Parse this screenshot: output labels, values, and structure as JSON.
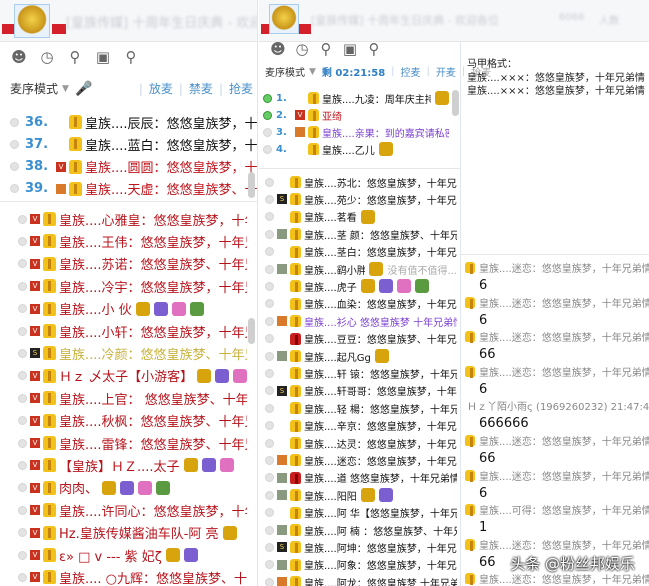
{
  "colors": {
    "accent": "#4a90c9",
    "name_red": "#b8141c",
    "purple": "#7b3fd0",
    "yellow": "#c9b23c"
  },
  "w1": {
    "title": "[皇族传媒] 十周年生日庆典 - 欢迎",
    "mode": "麦序模式",
    "actions": [
      "放麦",
      "禁麦",
      "抢麦"
    ],
    "top": [
      {
        "num": "36.",
        "name": "皇族....辰辰：悠悠皇族梦，十年",
        "color": "#111",
        "v": "none"
      },
      {
        "num": "37.",
        "name": "皇族....蓝白：悠悠皇族梦，十年",
        "color": "#111",
        "v": "none"
      },
      {
        "num": "38.",
        "name": "皇族....圆圆：悠悠皇族梦，十年",
        "color": "#c0141c",
        "v": "v"
      },
      {
        "num": "39.",
        "name": "皇族....天虚：悠悠皇族梦、十年",
        "color": "#c0141c",
        "v": "o"
      }
    ],
    "list": [
      {
        "name": "皇族....心雅皇：悠悠皇族梦，十年兄",
        "color": "#b8141c",
        "v": "v"
      },
      {
        "name": "皇族....王伟：悠悠皇族梦，十年兄弟",
        "color": "#b8141c",
        "v": "v"
      },
      {
        "name": "皇族....苏诺：悠悠皇族梦、十年兄弟",
        "color": "#b8141c",
        "v": "v"
      },
      {
        "name": "皇族....冷宇：悠悠皇族梦，十年兄弟",
        "color": "#b8141c",
        "v": "v"
      },
      {
        "name": "皇族....小  伙",
        "color": "#b8141c",
        "v": "v",
        "badges": 4
      },
      {
        "name": "皇族....小轩：悠悠皇族梦，十年兄弟",
        "color": "#b8141c",
        "v": "v"
      },
      {
        "name": "皇族....冷颜：悠悠皇族梦、十年兄弟",
        "color": "#c9b23c",
        "v": "s"
      },
      {
        "name": "Ｈｚ 乄太子【小游客】",
        "color": "#b8141c",
        "v": "v",
        "badges": 3
      },
      {
        "name": "皇族....上官： 悠悠皇族梦、十年兄",
        "color": "#b8141c",
        "v": "v"
      },
      {
        "name": "皇族....秋枫：悠悠皇族梦、十年兄弟",
        "color": "#b8141c",
        "v": "v"
      },
      {
        "name": "皇族....雷锋：悠悠皇族梦、十年兄弟",
        "color": "#b8141c",
        "v": "v"
      },
      {
        "name": "【皇族】ＨＺ....太子",
        "color": "#b8141c",
        "v": "v",
        "badges": 3
      },
      {
        "name": "肉肉、",
        "color": "#b8141c",
        "v": "v",
        "badges": 4
      },
      {
        "name": "皇族....许同心：悠悠皇族梦，十年兄",
        "color": "#b8141c",
        "v": "v"
      },
      {
        "name": "Hz.皇族传媒酱油车队-阿   亮",
        "color": "#b8141c",
        "v": "v",
        "badges": 1
      },
      {
        "name": "ε» □  v  ---   紫  妃ζ",
        "color": "#b8141c",
        "v": "v",
        "badges": 2
      },
      {
        "name": "皇族....  ○九辉：悠悠皇族梦、十年兄",
        "color": "#b8141c",
        "v": "v"
      }
    ]
  },
  "w2": {
    "title": "[皇族传媒] 十周年生日庆典 - 欢迎各位",
    "header_extra": [
      "6066",
      "人数"
    ],
    "mode": "麦序模式",
    "timer": "剩 02:21:58",
    "actions": [
      "控麦",
      "开麦",
      "抢麦"
    ],
    "top": [
      {
        "num": "1.",
        "name": "皇族....九凌：周年庆主持",
        "color": "#111",
        "v": "none"
      },
      {
        "num": "2.",
        "name": "亚绮",
        "color": "#c0141c",
        "v": "v"
      },
      {
        "num": "3.",
        "name": "皇族....亲果：到的嘉宾请私密我",
        "color": "#7b3fd0",
        "v": "o"
      },
      {
        "num": "4.",
        "name": "皇族....乙儿",
        "color": "#111",
        "v": "none"
      }
    ],
    "list": [
      {
        "name": "皇族....苏北：悠悠皇族梦，十年兄弟",
        "v": "none"
      },
      {
        "name": "皇族....苑少：悠悠皇族梦，十年兄弟",
        "v": "s"
      },
      {
        "name": "皇族....茗看",
        "v": "none",
        "badges": 1
      },
      {
        "name": "皇族....茎 颜：悠悠皇族梦、十年兄",
        "v": "g"
      },
      {
        "name": "皇族....茎白：悠悠皇族梦，十年兄弟",
        "v": "none"
      },
      {
        "name": "皇族....鹞小胖",
        "v": "g",
        "badges": 1,
        "note": "没有值不值得..."
      },
      {
        "name": "皇族....虎子",
        "v": "none",
        "badges": 4
      },
      {
        "name": "皇族....血染：悠悠皇族梦，十年兄弟",
        "v": "none"
      },
      {
        "name": "皇族....衫心 悠悠皇族梦 十年兄弟情",
        "v": "o",
        "color": "#7b3fd0"
      },
      {
        "name": "皇族....豆豆：悠悠皇族梦、十年兄弟",
        "v": "none",
        "red": true
      },
      {
        "name": "皇族....起凡Gg",
        "v": "g",
        "badges": 1
      },
      {
        "name": "皇族....轩 锿：悠悠皇族梦，十年兄",
        "v": "none"
      },
      {
        "name": "皇族....轩哥哥：悠悠皇族梦，十年兄",
        "v": "s"
      },
      {
        "name": "皇族....轻  楊：悠悠皇族梦，十年兄",
        "v": "none"
      },
      {
        "name": "皇族....辛京：悠悠皇族梦，十年兄弟",
        "v": "none"
      },
      {
        "name": "皇族....达灵：悠悠皇族梦，十年兄弟",
        "v": "none"
      },
      {
        "name": "皇族....迷恋：悠悠皇族梦，十年兄弟",
        "v": "o"
      },
      {
        "name": "皇族....道 悠悠皇族梦，十年兄弟情",
        "v": "g",
        "red": true
      },
      {
        "name": "皇族....阳阳",
        "v": "g",
        "badges": 2
      },
      {
        "name": "皇族....阿  华【悠悠皇族梦，十年兄",
        "v": "none"
      },
      {
        "name": "皇族....阿 楠 ：悠悠皇族梦、十年兄",
        "v": "g"
      },
      {
        "name": "皇族....阿坤：悠悠皇族梦，十年兄弟",
        "v": "s"
      },
      {
        "name": "皇族....阿象：悠悠皇族梦，十年兄弟",
        "v": "g"
      },
      {
        "name": "皇族....阿龙：悠悠皇族梦  十年兄弟",
        "v": "o"
      }
    ],
    "format": {
      "label": "马甲格式：",
      "lines": [
        "皇族....×××：悠悠皇族梦，十年兄弟情",
        "皇族....×××：悠悠皇族梦，十年兄弟情"
      ]
    },
    "messages": [
      {
        "from": "皇族....迷恋：悠悠皇族梦，十年兄弟情(",
        "text": "6"
      },
      {
        "from": "皇族....迷恋：悠悠皇族梦，十年兄弟情(",
        "text": "6"
      },
      {
        "from": "皇族....迷恋：悠悠皇族梦，十年兄弟情(",
        "text": "66"
      },
      {
        "from": "皇族....迷恋：悠悠皇族梦，十年兄弟情(",
        "text": "6"
      },
      {
        "from": "Ｈｚ丫陌小雨ς  (1969260232) 21:47:43",
        "text": "666666",
        "plain": true
      },
      {
        "from": "皇族....迷恋：悠悠皇族梦，十年兄弟情(",
        "text": "66"
      },
      {
        "from": "皇族....迷恋：悠悠皇族梦，十年兄弟情(",
        "text": "6"
      },
      {
        "from": "皇族....可得：悠悠皇族梦，十年兄弟情(",
        "text": "1"
      },
      {
        "from": "皇族....迷恋：悠悠皇族梦，十年兄弟情(",
        "text": "66"
      },
      {
        "from": "皇族....迷恋：悠悠皇族梦，十年兄弟情(",
        "text": ""
      }
    ]
  },
  "watermark": "头条 @粉丝邦娱乐"
}
